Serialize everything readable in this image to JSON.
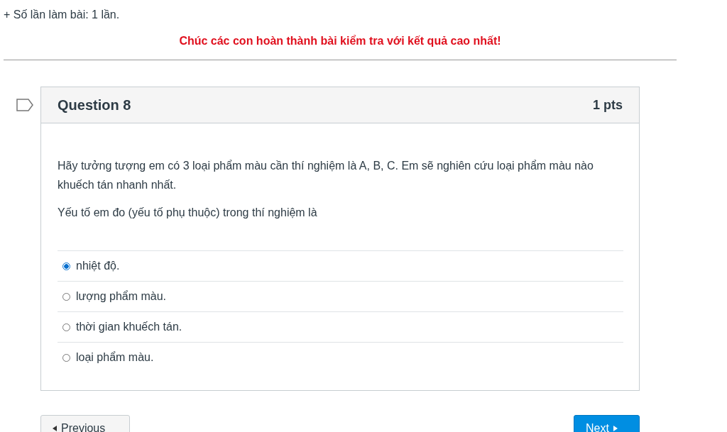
{
  "intro": "+ Số lần làm bài: 1 lần.",
  "greeting": "Chúc các con hoàn thành bài kiểm tra với kết quả cao nhất!",
  "question": {
    "title": "Question 8",
    "points": "1 pts",
    "paragraphs": [
      "Hãy tưởng tượng em có 3 loại phẩm màu cần thí nghiệm là A, B, C. Em sẽ nghiên cứu loại phẩm màu nào khuếch tán nhanh nhất.",
      "Yếu tố em đo (yếu tố phụ thuộc) trong thí nghiệm là"
    ],
    "answers": [
      {
        "label": "nhiệt độ.",
        "selected": true
      },
      {
        "label": "lượng phẩm màu.",
        "selected": false
      },
      {
        "label": "thời gian khuếch tán.",
        "selected": false
      },
      {
        "label": "loại phẩm màu.",
        "selected": false
      }
    ]
  },
  "buttons": {
    "previous": "Previous",
    "next": "Next"
  }
}
